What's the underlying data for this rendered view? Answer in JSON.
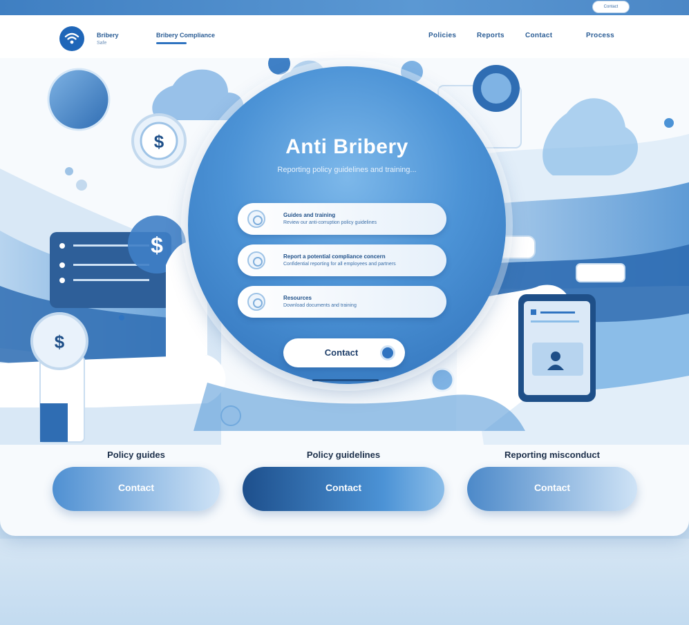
{
  "top": {
    "pill_label": "Contact"
  },
  "header": {
    "brand_name": "Bribery",
    "brand_sub": "Safe",
    "nav_title": "Bribery Compliance",
    "nav_items": [
      "Policies",
      "Reports",
      "Contact",
      "Process"
    ]
  },
  "hero": {
    "title": "Anti Bribery",
    "subtitle": "Reporting policy guidelines and training...",
    "options": [
      {
        "title": "Guides and training",
        "desc": "Review our anti-corruption policy guidelines"
      },
      {
        "title": "Report a potential compliance concern",
        "desc": "Confidential reporting for all employees and partners"
      },
      {
        "title": "Resources",
        "desc": "Download documents and training"
      }
    ],
    "contact_label": "Contact"
  },
  "sections": [
    {
      "title": "Policy guides",
      "button_label": "Contact"
    },
    {
      "title": "Policy guidelines",
      "button_label": "Contact"
    },
    {
      "title": "Reporting misconduct",
      "button_label": "Contact"
    }
  ],
  "colors": {
    "primary": "#2f73c0",
    "accent": "#4c93d6",
    "dark": "#1e4f88"
  }
}
